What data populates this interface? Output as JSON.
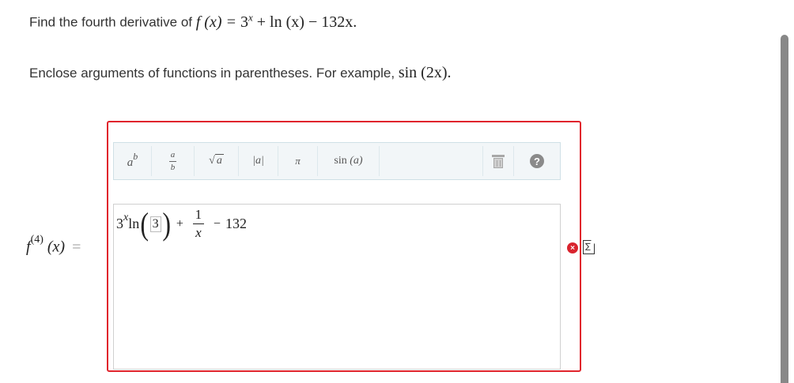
{
  "question": {
    "prefix": "Find the fourth derivative of",
    "function_lhs": "f (x) =",
    "function_rhs_part1": "3",
    "function_rhs_exp": "x",
    "function_rhs_part2": "+ ln (x) − 132x."
  },
  "hint": {
    "text": "Enclose arguments of functions in parentheses. For example,",
    "example": "sin (2x)."
  },
  "answer": {
    "label_f": "f",
    "label_order": "(4)",
    "label_arg": "(x)",
    "equals": "=",
    "expression": {
      "base": "3",
      "exp": "x",
      "func": "ln",
      "arg": "3",
      "plus": "+",
      "frac_num": "1",
      "frac_den": "x",
      "minus": "−",
      "const": "132"
    }
  },
  "toolbar": {
    "buttons": [
      {
        "name": "power",
        "base": "a",
        "exp": "b"
      },
      {
        "name": "fraction",
        "num": "a",
        "den": "b"
      },
      {
        "name": "sqrt",
        "arg": "a"
      },
      {
        "name": "abs",
        "label": "|a|"
      },
      {
        "name": "pi",
        "label": "π"
      },
      {
        "name": "sin",
        "label": "sin",
        "arg": "(a)"
      }
    ],
    "help_label": "?"
  },
  "status": {
    "error_symbol": "×",
    "preview_symbol": "∑"
  },
  "colors": {
    "error_border": "#e0242c",
    "toolbar_bg": "#f2f6f8",
    "scrollbar": "#888888"
  }
}
